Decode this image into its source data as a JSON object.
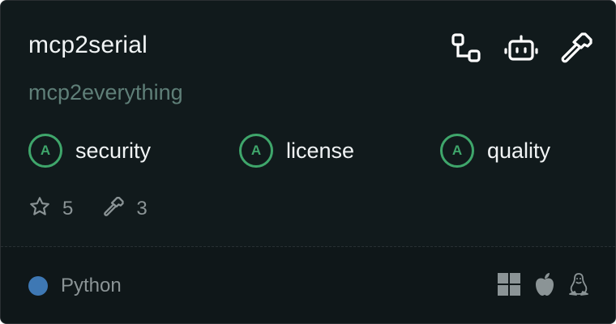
{
  "card": {
    "title": "mcp2serial",
    "owner": "mcp2everything",
    "header_icons": [
      "workflow-icon",
      "robot-icon",
      "hammer-icon"
    ],
    "grades": [
      {
        "grade": "A",
        "label": "security"
      },
      {
        "grade": "A",
        "label": "license"
      },
      {
        "grade": "A",
        "label": "quality"
      }
    ],
    "stats": {
      "stars": "5",
      "tools": "3"
    },
    "language": {
      "name": "Python",
      "color": "#3e78b4"
    },
    "platforms": [
      "windows-icon",
      "apple-icon",
      "linux-icon"
    ]
  },
  "colors": {
    "background": "#111a1c",
    "title": "#f1f4f5",
    "subtitle": "#5f7f78",
    "grade_green": "#3fa66b",
    "muted": "#8b9496"
  }
}
